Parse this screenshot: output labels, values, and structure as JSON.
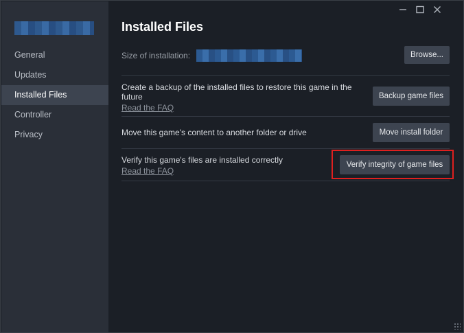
{
  "window": {
    "minimize_icon": "minimize-icon",
    "maximize_icon": "maximize-icon",
    "close_icon": "close-icon"
  },
  "sidebar": {
    "items": [
      {
        "label": "General",
        "active": false
      },
      {
        "label": "Updates",
        "active": false
      },
      {
        "label": "Installed Files",
        "active": true
      },
      {
        "label": "Controller",
        "active": false
      },
      {
        "label": "Privacy",
        "active": false
      }
    ]
  },
  "main": {
    "title": "Installed Files",
    "size_label": "Size of installation:",
    "browse_button": "Browse...",
    "backup": {
      "text": "Create a backup of the installed files to restore this game in the future",
      "link": "Read the FAQ",
      "button": "Backup game files"
    },
    "move": {
      "text": "Move this game's content to another folder or drive",
      "button": "Move install folder"
    },
    "verify": {
      "text": "Verify this game's files are installed correctly",
      "link": "Read the FAQ",
      "button": "Verify integrity of game files"
    }
  },
  "colors": {
    "background": "#1b1f26",
    "sidebar": "#2a2f38",
    "button": "#3d4450",
    "highlight": "#e0201f"
  }
}
